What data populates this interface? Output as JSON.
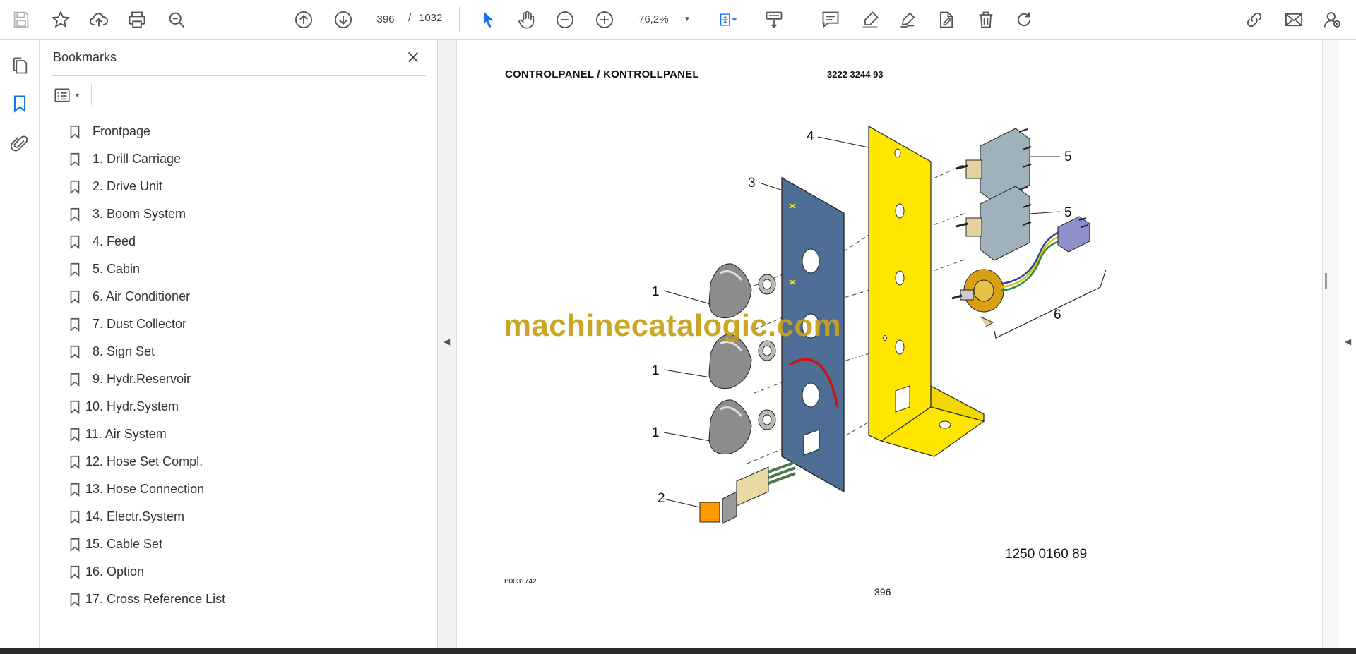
{
  "toolbar": {
    "current_page": "396",
    "page_separator": "/",
    "total_pages": "1032",
    "zoom": "76,2%",
    "icons": [
      "save-icon",
      "star-icon",
      "upload-icon",
      "print-icon",
      "search-zoom-icon",
      "arrow-up-icon",
      "arrow-down-icon",
      "select-cursor-icon",
      "hand-icon",
      "zoom-out-icon",
      "zoom-in-icon",
      "fit-page-icon",
      "scroll-mode-icon",
      "comment-icon",
      "highlight-icon",
      "draw-icon",
      "fill-sign-icon",
      "delete-icon",
      "redo-icon",
      "share-link-icon",
      "email-icon",
      "account-icon"
    ],
    "accent_color": "#1473e6"
  },
  "rail": {
    "items": [
      "pages-icon",
      "bookmark-icon",
      "attachment-icon"
    ]
  },
  "bookmarks_panel": {
    "title": "Bookmarks",
    "items": [
      {
        "label": "Frontpage"
      },
      {
        "label": "1. Drill Carriage"
      },
      {
        "label": "2. Drive Unit"
      },
      {
        "label": "3. Boom System"
      },
      {
        "label": "4. Feed"
      },
      {
        "label": "5. Cabin"
      },
      {
        "label": "6. Air Conditioner"
      },
      {
        "label": "7. Dust Collector"
      },
      {
        "label": "8. Sign Set"
      },
      {
        "label": "9. Hydr.Reservoir"
      },
      {
        "label": "10. Hydr.System"
      },
      {
        "label": "11. Air System"
      },
      {
        "label": "12. Hose Set Compl."
      },
      {
        "label": "13. Hose Connection"
      },
      {
        "label": "14. Electr.System"
      },
      {
        "label": "15. Cable Set"
      },
      {
        "label": "16. Option"
      },
      {
        "label": "17. Cross Reference List"
      }
    ]
  },
  "document": {
    "heading": "CONTROLPANEL / KONTROLLPANEL",
    "part_number": "3222 3244 93",
    "drawing_number": "1250 0160 89",
    "figure_ref": "B0031742",
    "page_number": "396",
    "watermark": "machinecatalogic.com",
    "callouts": {
      "c4": "4",
      "c3": "3",
      "c5a": "5",
      "c5b": "5",
      "c1a": "1",
      "c1b": "1",
      "c1c": "1",
      "c6": "6",
      "c2": "2"
    },
    "colors": {
      "yellow_plate": "#ffe600",
      "blue_plate": "#4f6e96",
      "watermark": "#c9a21a"
    }
  }
}
